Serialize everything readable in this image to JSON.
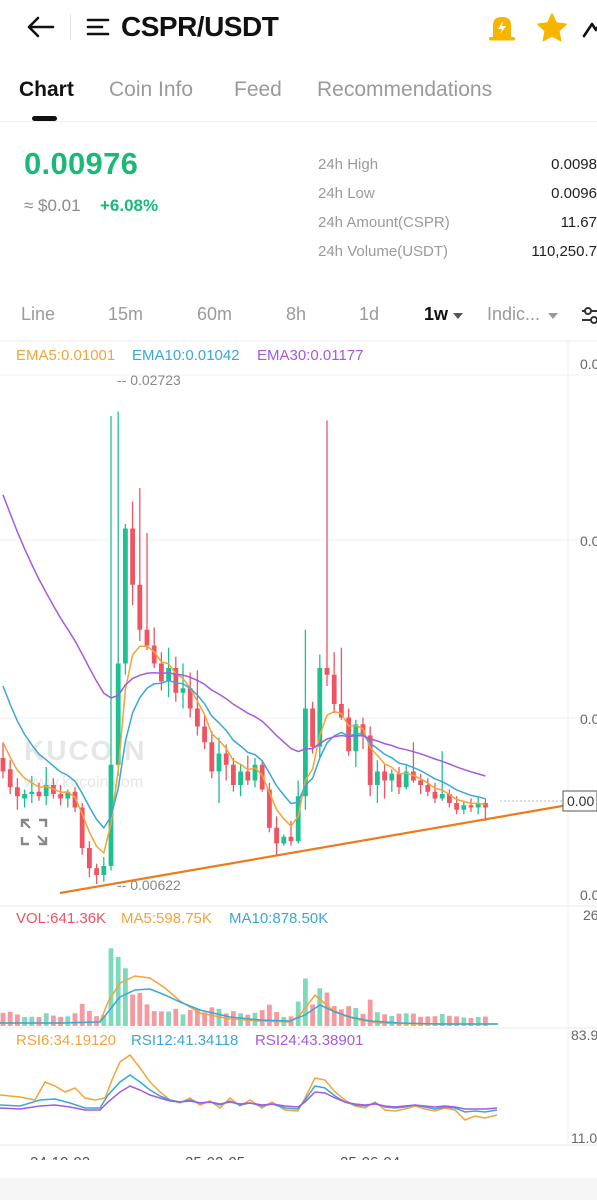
{
  "topbar": {
    "title": "CSPR/USDT"
  },
  "tabs": [
    "Chart",
    "Coin Info",
    "Feed",
    "Recommendations"
  ],
  "price": {
    "last": "0.00976",
    "fiat": "≈ $0.01",
    "change": "+6.08%"
  },
  "stats": [
    {
      "label": "24h High",
      "value": "0.0098"
    },
    {
      "label": "24h Low",
      "value": "0.0096"
    },
    {
      "label": "24h Amount(CSPR)",
      "value": "11.67"
    },
    {
      "label": "24h Volume(USDT)",
      "value": "110,250.7"
    }
  ],
  "intervals": [
    "Line",
    "15m",
    "60m",
    "8h",
    "1d",
    "1w",
    "Indic..."
  ],
  "indicators": {
    "ema": [
      "EMA5:0.01001",
      "EMA10:0.01042",
      "EMA30:0.01177"
    ],
    "vol": [
      "VOL:641.36K",
      "MA5:598.75K",
      "MA10:878.50K"
    ],
    "rsi": [
      "RSI6:34.19120",
      "RSI12:41.34118",
      "RSI24:43.38901"
    ]
  },
  "chart_axis": {
    "right_main": [
      "0.0",
      "0.0",
      "0.0",
      "0.0"
    ],
    "current_price_tag": "0.00",
    "vol_top": "26",
    "rsi_top": "83.9",
    "rsi_bottom": "11.0",
    "dates": [
      "24-10-02",
      "25-02-05",
      "25-06-04"
    ]
  },
  "annotations": {
    "high": "0.02723",
    "low": "0.00622"
  },
  "watermark": {
    "brand": "KUCOIN",
    "url": "www.kucoin.com"
  },
  "colors": {
    "up": "#1fc090",
    "down": "#ee5560",
    "ema5": "#f2a43a",
    "ema10": "#3aa7d8",
    "ema30": "#a35ae0",
    "trendline": "#f07a1a",
    "price_green": "#1bb978",
    "star": "#f7b500"
  },
  "chart_data": {
    "type": "candlestick",
    "period": "1w",
    "candles": [
      {
        "o": 0.0118,
        "h": 0.0125,
        "l": 0.0109,
        "c": 0.0112
      },
      {
        "o": 0.0113,
        "h": 0.0117,
        "l": 0.0102,
        "c": 0.0105
      },
      {
        "o": 0.0105,
        "h": 0.0109,
        "l": 0.0095,
        "c": 0.0101
      },
      {
        "o": 0.01,
        "h": 0.0104,
        "l": 0.0096,
        "c": 0.0102
      },
      {
        "o": 0.0102,
        "h": 0.011,
        "l": 0.0098,
        "c": 0.0103
      },
      {
        "o": 0.0103,
        "h": 0.0107,
        "l": 0.0099,
        "c": 0.0101
      },
      {
        "o": 0.0101,
        "h": 0.0114,
        "l": 0.0097,
        "c": 0.0106
      },
      {
        "o": 0.0106,
        "h": 0.0109,
        "l": 0.01,
        "c": 0.0102
      },
      {
        "o": 0.0102,
        "h": 0.0106,
        "l": 0.0097,
        "c": 0.01
      },
      {
        "o": 0.01,
        "h": 0.0104,
        "l": 0.0096,
        "c": 0.0103
      },
      {
        "o": 0.0103,
        "h": 0.0105,
        "l": 0.0094,
        "c": 0.0096
      },
      {
        "o": 0.0096,
        "h": 0.0098,
        "l": 0.0075,
        "c": 0.0078
      },
      {
        "o": 0.0078,
        "h": 0.0081,
        "l": 0.0065,
        "c": 0.0069
      },
      {
        "o": 0.0069,
        "h": 0.0071,
        "l": 0.0062,
        "c": 0.0066
      },
      {
        "o": 0.0066,
        "h": 0.0074,
        "l": 0.0063,
        "c": 0.007
      },
      {
        "o": 0.007,
        "h": 0.027,
        "l": 0.0068,
        "c": 0.0115
      },
      {
        "o": 0.0115,
        "h": 0.0272,
        "l": 0.011,
        "c": 0.016
      },
      {
        "o": 0.016,
        "h": 0.0222,
        "l": 0.0155,
        "c": 0.022
      },
      {
        "o": 0.022,
        "h": 0.0232,
        "l": 0.0186,
        "c": 0.0195
      },
      {
        "o": 0.0195,
        "h": 0.0238,
        "l": 0.017,
        "c": 0.0175
      },
      {
        "o": 0.0175,
        "h": 0.0218,
        "l": 0.0166,
        "c": 0.0168
      },
      {
        "o": 0.0168,
        "h": 0.0176,
        "l": 0.0158,
        "c": 0.016
      },
      {
        "o": 0.016,
        "h": 0.0165,
        "l": 0.0148,
        "c": 0.0152
      },
      {
        "o": 0.0152,
        "h": 0.0167,
        "l": 0.0145,
        "c": 0.0158
      },
      {
        "o": 0.0158,
        "h": 0.0163,
        "l": 0.0143,
        "c": 0.0147
      },
      {
        "o": 0.0147,
        "h": 0.016,
        "l": 0.014,
        "c": 0.0149
      },
      {
        "o": 0.0149,
        "h": 0.0156,
        "l": 0.0136,
        "c": 0.014
      },
      {
        "o": 0.014,
        "h": 0.0157,
        "l": 0.0128,
        "c": 0.0132
      },
      {
        "o": 0.0132,
        "h": 0.0137,
        "l": 0.0122,
        "c": 0.0125
      },
      {
        "o": 0.0125,
        "h": 0.013,
        "l": 0.0109,
        "c": 0.0112
      },
      {
        "o": 0.0112,
        "h": 0.0127,
        "l": 0.0098,
        "c": 0.012
      },
      {
        "o": 0.012,
        "h": 0.0124,
        "l": 0.0108,
        "c": 0.0115
      },
      {
        "o": 0.0115,
        "h": 0.0118,
        "l": 0.0103,
        "c": 0.0106
      },
      {
        "o": 0.0106,
        "h": 0.0115,
        "l": 0.0101,
        "c": 0.0112
      },
      {
        "o": 0.0112,
        "h": 0.0119,
        "l": 0.0106,
        "c": 0.0108
      },
      {
        "o": 0.0108,
        "h": 0.0118,
        "l": 0.0105,
        "c": 0.0115
      },
      {
        "o": 0.0115,
        "h": 0.0117,
        "l": 0.0103,
        "c": 0.0104
      },
      {
        "o": 0.0104,
        "h": 0.0107,
        "l": 0.0085,
        "c": 0.0087
      },
      {
        "o": 0.0087,
        "h": 0.0092,
        "l": 0.0075,
        "c": 0.008
      },
      {
        "o": 0.008,
        "h": 0.0084,
        "l": 0.0079,
        "c": 0.0083
      },
      {
        "o": 0.0083,
        "h": 0.009,
        "l": 0.0079,
        "c": 0.0081
      },
      {
        "o": 0.0081,
        "h": 0.0108,
        "l": 0.008,
        "c": 0.0101
      },
      {
        "o": 0.0101,
        "h": 0.0175,
        "l": 0.0095,
        "c": 0.014
      },
      {
        "o": 0.014,
        "h": 0.0143,
        "l": 0.012,
        "c": 0.0123
      },
      {
        "o": 0.0123,
        "h": 0.0164,
        "l": 0.0118,
        "c": 0.0158
      },
      {
        "o": 0.0158,
        "h": 0.0268,
        "l": 0.015,
        "c": 0.0155
      },
      {
        "o": 0.0155,
        "h": 0.0165,
        "l": 0.0138,
        "c": 0.0142
      },
      {
        "o": 0.0142,
        "h": 0.0167,
        "l": 0.0135,
        "c": 0.0136
      },
      {
        "o": 0.0136,
        "h": 0.014,
        "l": 0.0119,
        "c": 0.0121
      },
      {
        "o": 0.0121,
        "h": 0.0135,
        "l": 0.0114,
        "c": 0.0133
      },
      {
        "o": 0.0133,
        "h": 0.0136,
        "l": 0.0122,
        "c": 0.0128
      },
      {
        "o": 0.0128,
        "h": 0.0132,
        "l": 0.0101,
        "c": 0.0106
      },
      {
        "o": 0.0106,
        "h": 0.0117,
        "l": 0.0098,
        "c": 0.0112
      },
      {
        "o": 0.0112,
        "h": 0.0115,
        "l": 0.01,
        "c": 0.0108
      },
      {
        "o": 0.0108,
        "h": 0.0113,
        "l": 0.0103,
        "c": 0.0111
      },
      {
        "o": 0.0111,
        "h": 0.0114,
        "l": 0.0102,
        "c": 0.0105
      },
      {
        "o": 0.0105,
        "h": 0.0115,
        "l": 0.0104,
        "c": 0.0112
      },
      {
        "o": 0.0112,
        "h": 0.0125,
        "l": 0.0107,
        "c": 0.0108
      },
      {
        "o": 0.0108,
        "h": 0.0111,
        "l": 0.0102,
        "c": 0.0106
      },
      {
        "o": 0.0106,
        "h": 0.0109,
        "l": 0.0101,
        "c": 0.0103
      },
      {
        "o": 0.0103,
        "h": 0.0107,
        "l": 0.0098,
        "c": 0.01
      },
      {
        "o": 0.01,
        "h": 0.0121,
        "l": 0.0099,
        "c": 0.0102
      },
      {
        "o": 0.0102,
        "h": 0.0104,
        "l": 0.0096,
        "c": 0.0098
      },
      {
        "o": 0.0098,
        "h": 0.0101,
        "l": 0.0093,
        "c": 0.0095
      },
      {
        "o": 0.0095,
        "h": 0.0099,
        "l": 0.0093,
        "c": 0.0097
      },
      {
        "o": 0.0097,
        "h": 0.01,
        "l": 0.0094,
        "c": 0.0096
      },
      {
        "o": 0.0096,
        "h": 0.0101,
        "l": 0.0093,
        "c": 0.0098
      },
      {
        "o": 0.0098,
        "h": 0.01,
        "l": 0.009,
        "c": 0.0096
      }
    ],
    "ema5": {
      "name": "EMA5",
      "value": 0.01001
    },
    "ema10": {
      "name": "EMA10",
      "value": 0.01042
    },
    "ema30": {
      "name": "EMA30",
      "value": 0.01177
    },
    "ylim": [
      0.0058,
      0.0286
    ],
    "high_label": 0.02723,
    "low_label": 0.00622
  }
}
